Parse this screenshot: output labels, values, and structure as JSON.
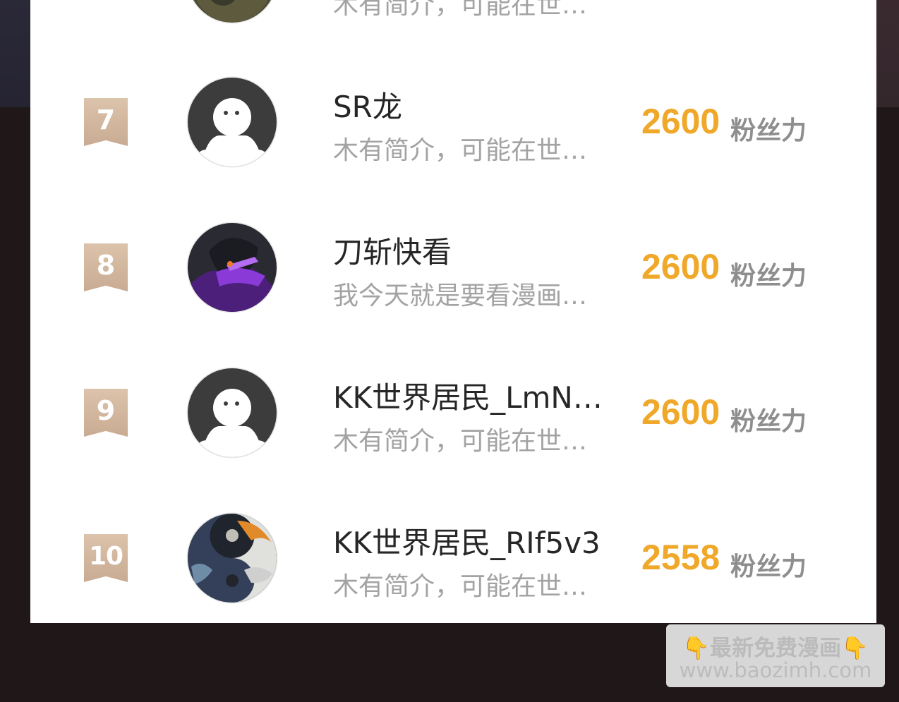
{
  "partial_top_row": {
    "bio": "木有简介，可能在世…"
  },
  "rows": [
    {
      "rank": "7",
      "name": "SR龙",
      "bio": "木有简介，可能在世…",
      "score": "2600",
      "unit": "粉丝力",
      "avatar": "default"
    },
    {
      "rank": "8",
      "name": "刀斩快看",
      "bio": "我今天就是要看漫画…",
      "score": "2600",
      "unit": "粉丝力",
      "avatar": "photo-purple"
    },
    {
      "rank": "9",
      "name": "KK世界居民_LmN…",
      "bio": "木有简介，可能在世…",
      "score": "2600",
      "unit": "粉丝力",
      "avatar": "default"
    },
    {
      "rank": "10",
      "name": "KK世界居民_RIf5v3",
      "bio": "木有简介，可能在世…",
      "score": "2558",
      "unit": "粉丝力",
      "avatar": "photo-yinyang"
    }
  ],
  "watermark": {
    "line1": "最新免费漫画",
    "line2": "www.baozimh.com",
    "finger_icon": "👇"
  },
  "colors": {
    "score": "#f0a82a",
    "rank_badge": "#d4b79e",
    "background": "#1f1718"
  }
}
